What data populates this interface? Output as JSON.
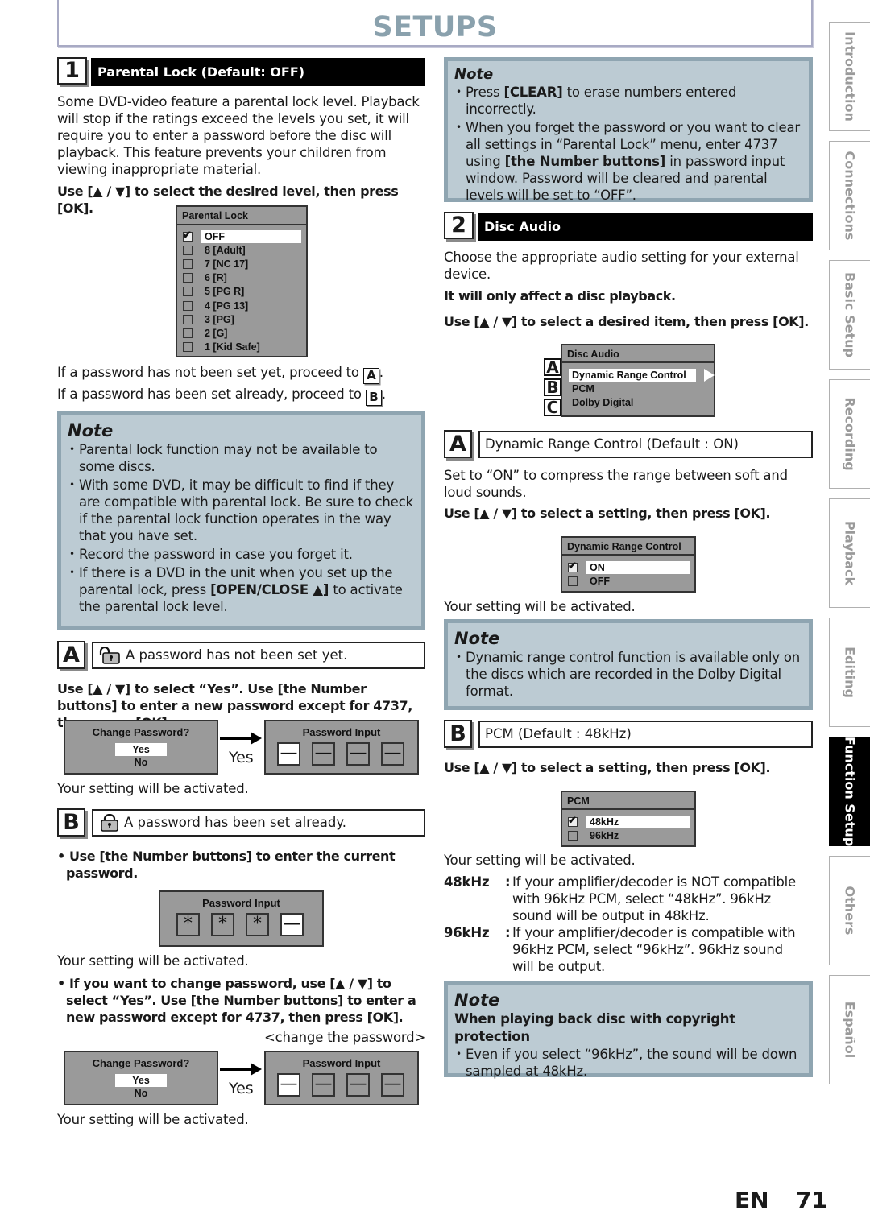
{
  "header": {
    "title": "SETUPS"
  },
  "side_tabs": [
    {
      "label": "Introduction",
      "active": false
    },
    {
      "label": "Connections",
      "active": false
    },
    {
      "label": "Basic Setup",
      "active": false
    },
    {
      "label": "Recording",
      "active": false
    },
    {
      "label": "Playback",
      "active": false
    },
    {
      "label": "Editing",
      "active": false
    },
    {
      "label": "Function Setup",
      "active": true
    },
    {
      "label": "Others",
      "active": false
    },
    {
      "label": "Español",
      "active": false
    }
  ],
  "section1": {
    "number": "1",
    "title": "Parental Lock (Default: OFF)",
    "intro": "Some DVD-video feature a parental lock level. Playback will stop if the ratings exceed the levels you set, it will require you to enter a password before the disc will playback. This feature prevents your children from viewing inappropriate material.",
    "instruction": "Use [▲ / ▼] to select the desired level, then press [OK].",
    "osd": {
      "title": "Parental Lock",
      "items": [
        {
          "label": "OFF",
          "checked": true,
          "selected": true
        },
        {
          "label": "8 [Adult]",
          "checked": false,
          "selected": false
        },
        {
          "label": "7 [NC 17]",
          "checked": false,
          "selected": false
        },
        {
          "label": "6 [R]",
          "checked": false,
          "selected": false
        },
        {
          "label": "5 [PG R]",
          "checked": false,
          "selected": false
        },
        {
          "label": "4 [PG 13]",
          "checked": false,
          "selected": false
        },
        {
          "label": "3 [PG]",
          "checked": false,
          "selected": false
        },
        {
          "label": "2 [G]",
          "checked": false,
          "selected": false
        },
        {
          "label": "1 [Kid Safe]",
          "checked": false,
          "selected": false
        }
      ]
    },
    "proceed_a": "If a password has not been set yet, proceed to",
    "proceed_b": "If a password has been set already, proceed to",
    "proceed_a_tag": "A",
    "proceed_b_tag": "B",
    "proceed_suffix": ".",
    "note": {
      "title": "Note",
      "items": [
        "Parental lock function may not be available to some discs.",
        "With some DVD, it may be difficult to find if they are compatible with parental lock. Be sure to check if the parental lock function operates in the way that you have set.",
        "Record the password in case you forget it.",
        "If there is a DVD in the unit when you set up the parental lock, press [OPEN/CLOSE ▲] to activate the parental lock level."
      ]
    },
    "sub_a": {
      "letter": "A",
      "title": "A password has not been set yet.",
      "icon": "unlocked-padlock-icon",
      "instruction": "Use [▲ / ▼] to select “Yes”. Use [the Number buttons] to enter a new password except for 4737, then press [OK].",
      "change_title": "Change Password?",
      "options": [
        "Yes",
        "No"
      ],
      "arrow_label": "Yes",
      "pw_title": "Password Input",
      "pw_slots": [
        "—",
        "—",
        "—",
        "—"
      ],
      "result": "Your setting will be activated."
    },
    "sub_b": {
      "letter": "B",
      "title": "A password has been set already.",
      "icon": "locked-padlock-icon",
      "instruction1": "Use [the Number buttons] to enter the current password.",
      "pw_title": "Password Input",
      "pw_slots": [
        "*",
        "*",
        "*",
        "—"
      ],
      "result1": "Your setting will be activated.",
      "instruction2": "If you want to change password, use [▲ / ▼] to select “Yes”. Use [the Number buttons] to enter a new password except for 4737, then press [OK].",
      "caption": "<change the password>",
      "change_title": "Change Password?",
      "options": [
        "Yes",
        "No"
      ],
      "arrow_label": "Yes",
      "pw2_title": "Password Input",
      "pw2_slots": [
        "—",
        "—",
        "—",
        "—"
      ],
      "result2": "Your setting will be activated."
    }
  },
  "right_note": {
    "title": "Note",
    "items": [
      "Press [CLEAR] to erase numbers entered incorrectly.",
      "When you forget the password or you want to clear all settings in “Parental Lock” menu, enter 4737 using [the Number buttons] in password input window. Password will be cleared and parental levels will be set to “OFF”."
    ]
  },
  "section2": {
    "number": "2",
    "title": "Disc Audio",
    "intro": "Choose the appropriate audio setting for your external device.",
    "emphasis": "It will only affect a disc playback.",
    "instruction": "Use [▲ / ▼] to select a desired item, then press [OK].",
    "osd": {
      "title": "Disc Audio",
      "items": [
        {
          "tag": "A",
          "label": "Dynamic Range Control",
          "selected": true
        },
        {
          "tag": "B",
          "label": "PCM",
          "selected": false
        },
        {
          "tag": "C",
          "label": "Dolby Digital",
          "selected": false
        }
      ]
    },
    "sub_a": {
      "letter": "A",
      "title": "Dynamic Range Control (Default : ON)",
      "desc": "Set to “ON” to compress the range between soft and loud sounds.",
      "instruction": "Use [▲ / ▼] to select a setting, then press [OK].",
      "osd_title": "Dynamic Range Control",
      "options": [
        {
          "label": "ON",
          "checked": true,
          "selected": true
        },
        {
          "label": "OFF",
          "checked": false,
          "selected": false
        }
      ],
      "result": "Your setting will be activated.",
      "note_title": "Note",
      "note_items": [
        "Dynamic range control function is available only on the discs which are recorded in the Dolby Digital format."
      ]
    },
    "sub_b": {
      "letter": "B",
      "title": "PCM (Default : 48kHz)",
      "instruction": "Use [▲ / ▼] to select a setting, then press [OK].",
      "osd_title": "PCM",
      "options": [
        {
          "label": "48kHz",
          "checked": true,
          "selected": true
        },
        {
          "label": "96kHz",
          "checked": false,
          "selected": false
        }
      ],
      "result": "Your setting will be activated.",
      "definitions": [
        {
          "key": "48kHz",
          "colon": ":",
          "value": "If your amplifier/decoder is NOT compatible with 96kHz PCM, select “48kHz”. 96kHz sound will be output in 48kHz."
        },
        {
          "key": "96kHz",
          "colon": ":",
          "value": "If your amplifier/decoder is compatible with 96kHz PCM, select “96kHz”. 96kHz sound will be output."
        }
      ],
      "note_title": "Note",
      "note_subtitle": "When playing back disc with copyright protection",
      "note_items": [
        "Even if you select “96kHz”, the sound will be down sampled at 48kHz."
      ]
    }
  },
  "footer": {
    "lang": "EN",
    "page": "71"
  }
}
